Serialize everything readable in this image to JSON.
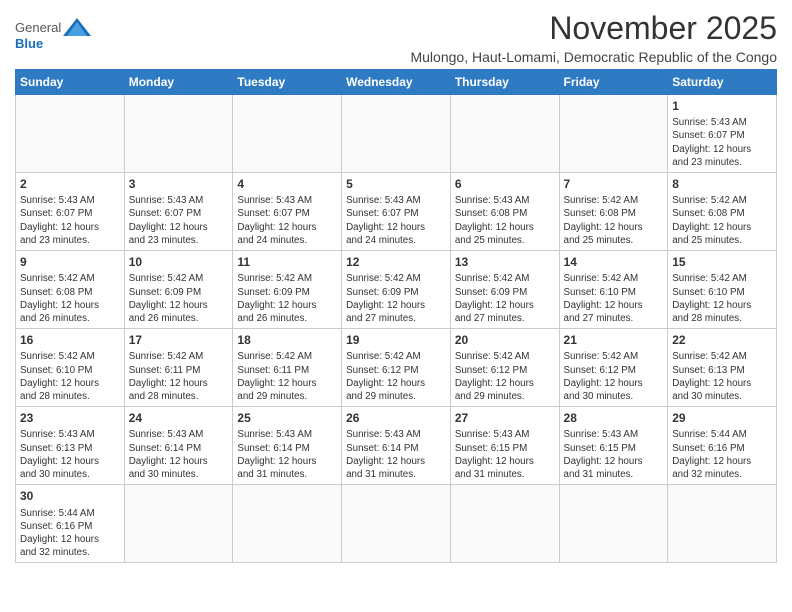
{
  "header": {
    "logo_general": "General",
    "logo_blue": "Blue",
    "month_title": "November 2025",
    "location": "Mulongo, Haut-Lomami, Democratic Republic of the Congo"
  },
  "days_of_week": [
    "Sunday",
    "Monday",
    "Tuesday",
    "Wednesday",
    "Thursday",
    "Friday",
    "Saturday"
  ],
  "weeks": [
    [
      {
        "day": "",
        "info": ""
      },
      {
        "day": "",
        "info": ""
      },
      {
        "day": "",
        "info": ""
      },
      {
        "day": "",
        "info": ""
      },
      {
        "day": "",
        "info": ""
      },
      {
        "day": "",
        "info": ""
      },
      {
        "day": "1",
        "info": "Sunrise: 5:43 AM\nSunset: 6:07 PM\nDaylight: 12 hours\nand 23 minutes."
      }
    ],
    [
      {
        "day": "2",
        "info": "Sunrise: 5:43 AM\nSunset: 6:07 PM\nDaylight: 12 hours\nand 23 minutes."
      },
      {
        "day": "3",
        "info": "Sunrise: 5:43 AM\nSunset: 6:07 PM\nDaylight: 12 hours\nand 23 minutes."
      },
      {
        "day": "4",
        "info": "Sunrise: 5:43 AM\nSunset: 6:07 PM\nDaylight: 12 hours\nand 24 minutes."
      },
      {
        "day": "5",
        "info": "Sunrise: 5:43 AM\nSunset: 6:07 PM\nDaylight: 12 hours\nand 24 minutes."
      },
      {
        "day": "6",
        "info": "Sunrise: 5:43 AM\nSunset: 6:08 PM\nDaylight: 12 hours\nand 25 minutes."
      },
      {
        "day": "7",
        "info": "Sunrise: 5:42 AM\nSunset: 6:08 PM\nDaylight: 12 hours\nand 25 minutes."
      },
      {
        "day": "8",
        "info": "Sunrise: 5:42 AM\nSunset: 6:08 PM\nDaylight: 12 hours\nand 25 minutes."
      }
    ],
    [
      {
        "day": "9",
        "info": "Sunrise: 5:42 AM\nSunset: 6:08 PM\nDaylight: 12 hours\nand 26 minutes."
      },
      {
        "day": "10",
        "info": "Sunrise: 5:42 AM\nSunset: 6:09 PM\nDaylight: 12 hours\nand 26 minutes."
      },
      {
        "day": "11",
        "info": "Sunrise: 5:42 AM\nSunset: 6:09 PM\nDaylight: 12 hours\nand 26 minutes."
      },
      {
        "day": "12",
        "info": "Sunrise: 5:42 AM\nSunset: 6:09 PM\nDaylight: 12 hours\nand 27 minutes."
      },
      {
        "day": "13",
        "info": "Sunrise: 5:42 AM\nSunset: 6:09 PM\nDaylight: 12 hours\nand 27 minutes."
      },
      {
        "day": "14",
        "info": "Sunrise: 5:42 AM\nSunset: 6:10 PM\nDaylight: 12 hours\nand 27 minutes."
      },
      {
        "day": "15",
        "info": "Sunrise: 5:42 AM\nSunset: 6:10 PM\nDaylight: 12 hours\nand 28 minutes."
      }
    ],
    [
      {
        "day": "16",
        "info": "Sunrise: 5:42 AM\nSunset: 6:10 PM\nDaylight: 12 hours\nand 28 minutes."
      },
      {
        "day": "17",
        "info": "Sunrise: 5:42 AM\nSunset: 6:11 PM\nDaylight: 12 hours\nand 28 minutes."
      },
      {
        "day": "18",
        "info": "Sunrise: 5:42 AM\nSunset: 6:11 PM\nDaylight: 12 hours\nand 29 minutes."
      },
      {
        "day": "19",
        "info": "Sunrise: 5:42 AM\nSunset: 6:12 PM\nDaylight: 12 hours\nand 29 minutes."
      },
      {
        "day": "20",
        "info": "Sunrise: 5:42 AM\nSunset: 6:12 PM\nDaylight: 12 hours\nand 29 minutes."
      },
      {
        "day": "21",
        "info": "Sunrise: 5:42 AM\nSunset: 6:12 PM\nDaylight: 12 hours\nand 30 minutes."
      },
      {
        "day": "22",
        "info": "Sunrise: 5:42 AM\nSunset: 6:13 PM\nDaylight: 12 hours\nand 30 minutes."
      }
    ],
    [
      {
        "day": "23",
        "info": "Sunrise: 5:43 AM\nSunset: 6:13 PM\nDaylight: 12 hours\nand 30 minutes."
      },
      {
        "day": "24",
        "info": "Sunrise: 5:43 AM\nSunset: 6:14 PM\nDaylight: 12 hours\nand 30 minutes."
      },
      {
        "day": "25",
        "info": "Sunrise: 5:43 AM\nSunset: 6:14 PM\nDaylight: 12 hours\nand 31 minutes."
      },
      {
        "day": "26",
        "info": "Sunrise: 5:43 AM\nSunset: 6:14 PM\nDaylight: 12 hours\nand 31 minutes."
      },
      {
        "day": "27",
        "info": "Sunrise: 5:43 AM\nSunset: 6:15 PM\nDaylight: 12 hours\nand 31 minutes."
      },
      {
        "day": "28",
        "info": "Sunrise: 5:43 AM\nSunset: 6:15 PM\nDaylight: 12 hours\nand 31 minutes."
      },
      {
        "day": "29",
        "info": "Sunrise: 5:44 AM\nSunset: 6:16 PM\nDaylight: 12 hours\nand 32 minutes."
      }
    ],
    [
      {
        "day": "30",
        "info": "Sunrise: 5:44 AM\nSunset: 6:16 PM\nDaylight: 12 hours\nand 32 minutes."
      },
      {
        "day": "",
        "info": ""
      },
      {
        "day": "",
        "info": ""
      },
      {
        "day": "",
        "info": ""
      },
      {
        "day": "",
        "info": ""
      },
      {
        "day": "",
        "info": ""
      },
      {
        "day": "",
        "info": ""
      }
    ]
  ]
}
